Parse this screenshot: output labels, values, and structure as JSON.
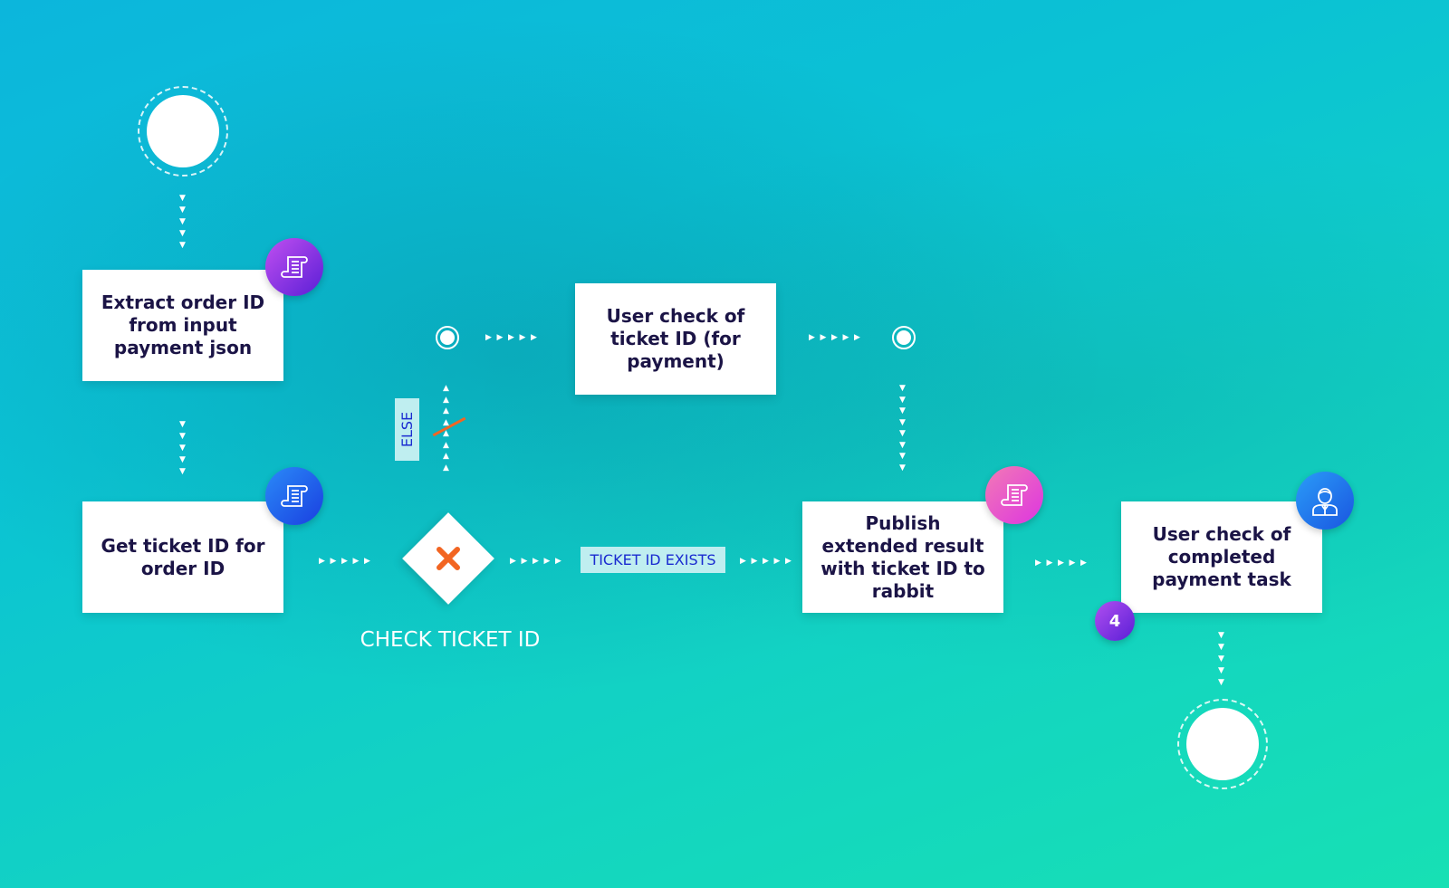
{
  "nodes": {
    "extract": {
      "label": "Extract order ID from input payment json",
      "icon": "scroll-icon",
      "icon_color": "#8a2be2"
    },
    "get_ticket": {
      "label": "Get ticket ID for order ID",
      "icon": "scroll-icon",
      "icon_color": "#1e6cf0"
    },
    "user_check_ticket": {
      "label": "User check of ticket ID (for payment)"
    },
    "publish": {
      "label": "Publish extended result with ticket ID to rabbit",
      "icon": "scroll-icon",
      "icon_color": "#e94fc8"
    },
    "user_check_completed": {
      "label": "User check of completed payment task",
      "icon": "user-icon",
      "icon_color": "#1e7cf5",
      "badge": "4"
    }
  },
  "gateway": {
    "label": "CHECK TICKET ID",
    "icon": "x-icon",
    "color": "#f26522"
  },
  "edges": {
    "else_label": "ELSE",
    "exists_label": "TICKET ID EXISTS"
  },
  "colors": {
    "bg_start": "#0cb6dc",
    "bg_end": "#17e0b4",
    "text": "#1b1446"
  }
}
